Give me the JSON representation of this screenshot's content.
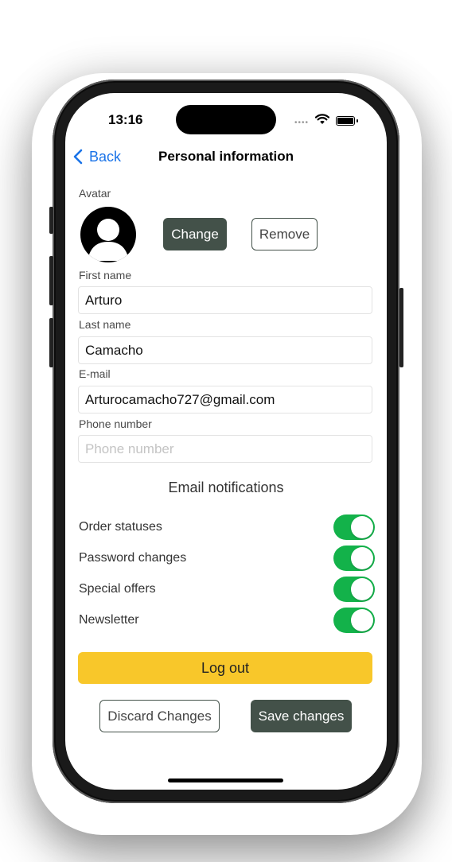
{
  "status_bar": {
    "time": "13:16"
  },
  "nav": {
    "back_label": "Back",
    "title": "Personal information"
  },
  "avatar": {
    "label": "Avatar",
    "change_label": "Change",
    "remove_label": "Remove"
  },
  "form": {
    "first_name": {
      "label": "First name",
      "value": "Arturo",
      "placeholder": ""
    },
    "last_name": {
      "label": "Last name",
      "value": "Camacho",
      "placeholder": ""
    },
    "email": {
      "label": "E-mail",
      "value": "Arturocamacho727@gmail.com",
      "placeholder": ""
    },
    "phone": {
      "label": "Phone number",
      "value": "",
      "placeholder": "Phone number"
    }
  },
  "notifications": {
    "title": "Email notifications",
    "items": [
      {
        "label": "Order statuses",
        "enabled": true
      },
      {
        "label": "Password changes",
        "enabled": true
      },
      {
        "label": "Special offers",
        "enabled": true
      },
      {
        "label": "Newsletter",
        "enabled": true
      }
    ]
  },
  "actions": {
    "logout_label": "Log out",
    "discard_label": "Discard Changes",
    "save_label": "Save changes"
  },
  "colors": {
    "accent_dark": "#435149",
    "toggle_on": "#13b24a",
    "logout_yellow": "#f8c72a",
    "link_blue": "#1a73e8"
  }
}
